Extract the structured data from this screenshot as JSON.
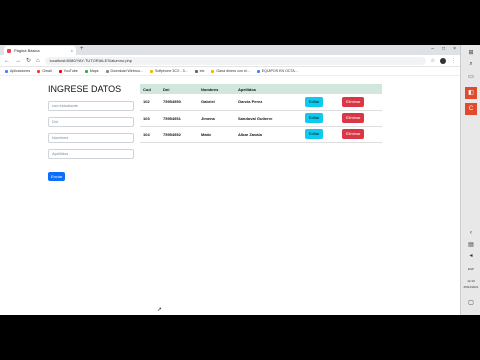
{
  "browser": {
    "tab_title": "Página Básica",
    "tab_close": "×",
    "new_tab": "+",
    "window_controls": [
      "–",
      "□",
      "×"
    ],
    "url": "localhost:8080/YAY-TUTORIALES/alumno.php",
    "nav_icons": [
      "←",
      "→",
      "↻",
      "⌂"
    ],
    "ext_icons": [
      "☆",
      "⋮"
    ]
  },
  "bookmarks": [
    {
      "label": "Aplicaciones",
      "color": "#4285f4"
    },
    {
      "label": "Gmail",
      "color": "#ea4335"
    },
    {
      "label": "YouTube",
      "color": "#ff0000"
    },
    {
      "label": "Maps",
      "color": "#34a853"
    },
    {
      "label": "Download Webroo...",
      "color": "#888888"
    },
    {
      "label": "Softphone 3CX - 3...",
      "color": "#f4b400"
    },
    {
      "label": "elo",
      "color": "#666666"
    },
    {
      "label": "Gana dinero con el...",
      "color": "#f4b400"
    },
    {
      "label": "EQUIPOS EN OCTA...",
      "color": "#4285f4"
    }
  ],
  "form": {
    "title": "INGRESE DATOS",
    "fields": [
      {
        "placeholder": "cod estudiante"
      },
      {
        "placeholder": "Dni"
      },
      {
        "placeholder": "Nombres"
      },
      {
        "placeholder": "Apellidos"
      }
    ],
    "submit_label": "Enviar"
  },
  "table": {
    "headers": [
      "Cod",
      "Dni",
      "Nombres",
      "Apellidos",
      "",
      ""
    ],
    "rows": [
      {
        "cod": "102",
        "dni": "75954550",
        "nombres": "Gabriel",
        "apellidos": "Garcia Perez",
        "edit": "Editar",
        "delete": "Eliminar"
      },
      {
        "cod": "103",
        "dni": "75954551",
        "nombres": "Jimena",
        "apellidos": "Sandoval Gutierre",
        "edit": "Editar",
        "delete": "Eliminar"
      },
      {
        "cod": "104",
        "dni": "75954552",
        "nombres": "Matic",
        "apellidos": "Albar Zavala",
        "edit": "Editar",
        "delete": "Eliminar"
      }
    ]
  },
  "taskbar": {
    "language": "ESP",
    "time": "12:16",
    "date": "25/01/2021"
  },
  "colors": {
    "primary": "#0d6efd",
    "info": "#0dcaf0",
    "danger": "#dc3545",
    "table_header": "#d1e7dd"
  }
}
